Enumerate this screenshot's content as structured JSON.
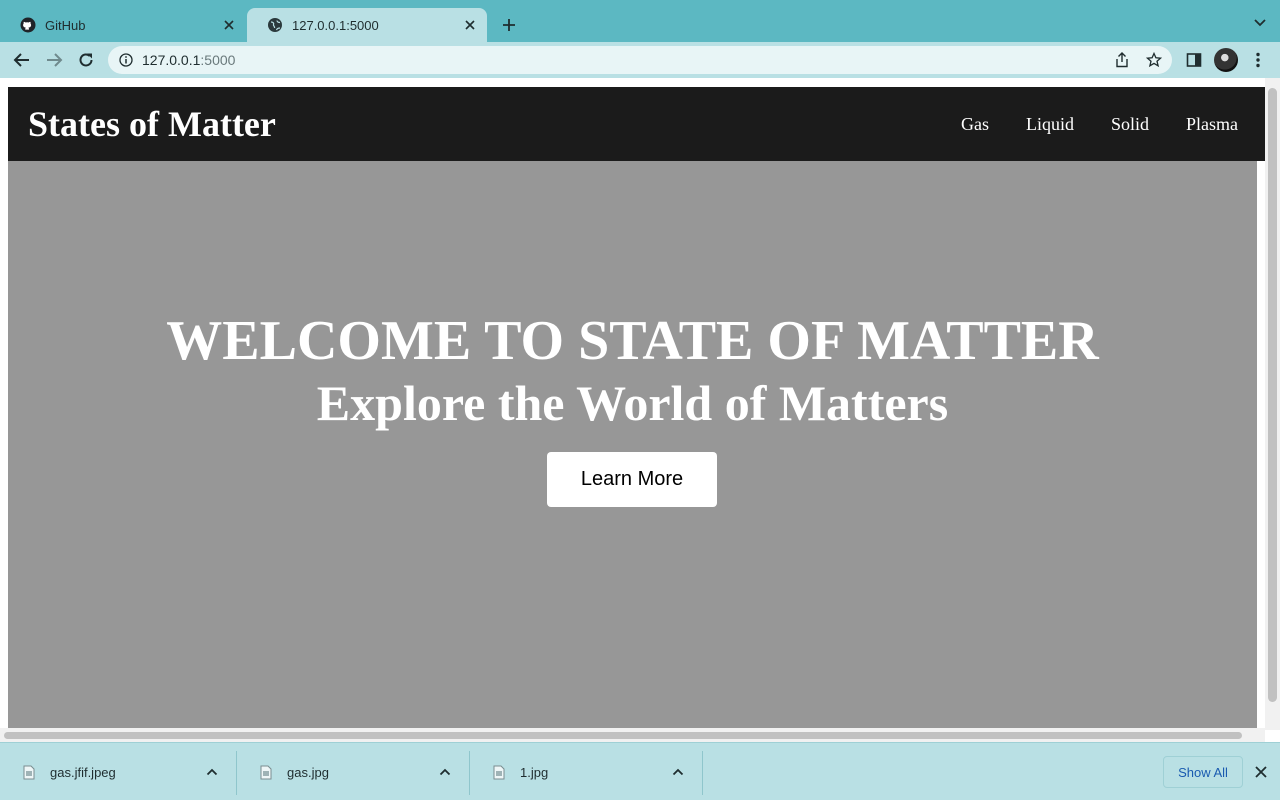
{
  "browser": {
    "tabs": [
      {
        "title": "GitHub",
        "icon": "github-icon",
        "active": false
      },
      {
        "title": "127.0.0.1:5000",
        "icon": "globe-icon",
        "active": true
      }
    ],
    "url_host": "127.0.0.1",
    "url_port": ":5000"
  },
  "site": {
    "logo": "States of Matter",
    "nav": [
      "Gas",
      "Liquid",
      "Solid",
      "Plasma"
    ],
    "hero_title": "WELCOME TO STATE OF MATTER",
    "hero_subtitle": "Explore the World of Matters",
    "hero_button": "Learn More"
  },
  "downloads": {
    "items": [
      "gas.jfif.jpeg",
      "gas.jpg",
      "1.jpg"
    ],
    "show_all": "Show All"
  },
  "colors": {
    "tabstrip": "#5cb8c2",
    "toolbar": "#b9e0e4",
    "site_nav": "#1b1b1b",
    "hero_bg": "#979797",
    "link": "#1a5bb0"
  }
}
